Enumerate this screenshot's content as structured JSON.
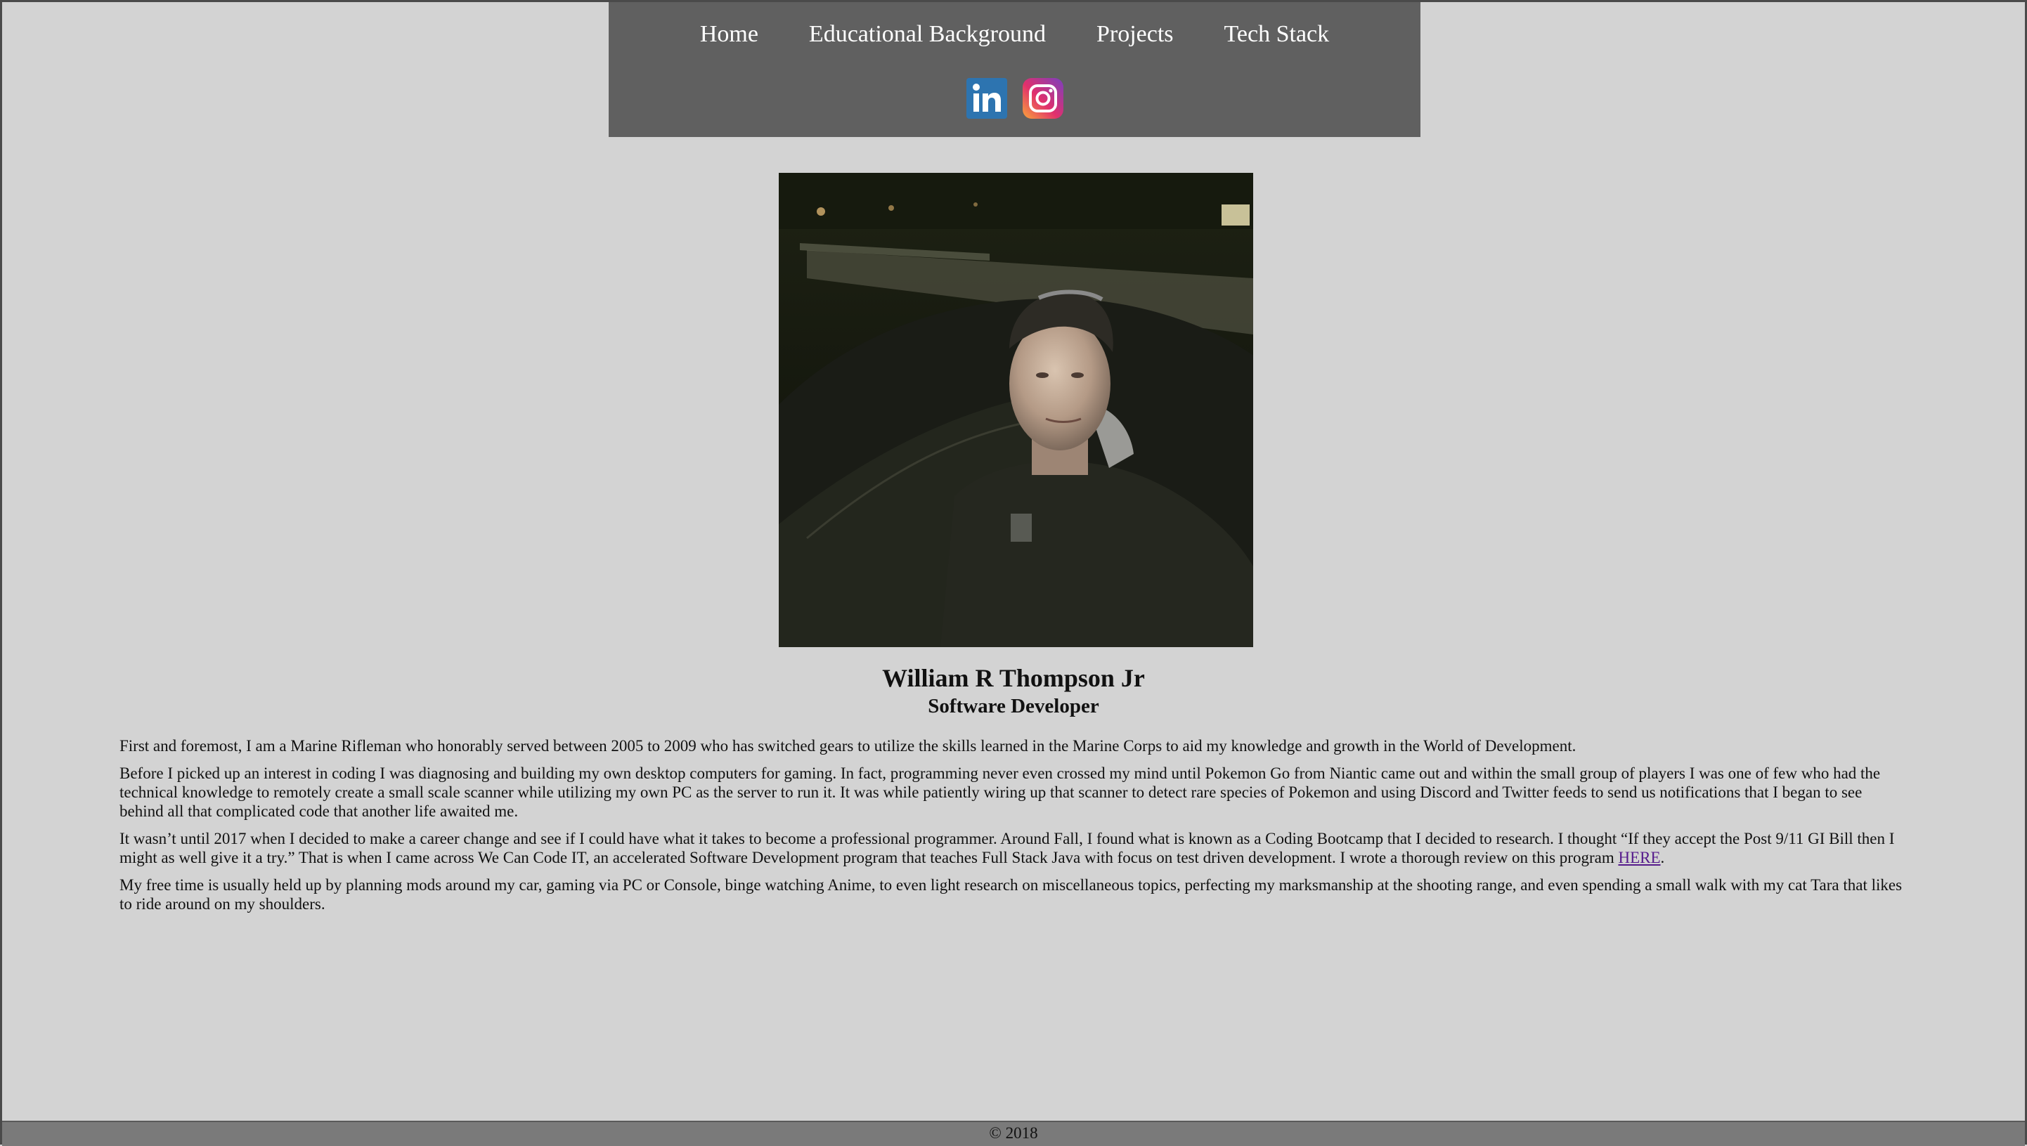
{
  "nav": {
    "links": [
      {
        "label": "Home"
      },
      {
        "label": "Educational Background"
      },
      {
        "label": "Projects"
      },
      {
        "label": "Tech Stack"
      }
    ],
    "social": [
      {
        "icon": "linkedin-icon",
        "color": "#2d74b0"
      },
      {
        "icon": "instagram-icon",
        "color": "#d62976"
      }
    ]
  },
  "profile": {
    "name": "William R Thompson Jr",
    "role": "Software Developer"
  },
  "bio": {
    "p1": "First and foremost, I am a Marine Rifleman who honorably served between 2005 to 2009 who has switched gears to utilize the skills learned in the Marine Corps to aid my knowledge and growth in the World of Development.",
    "p2": "Before I picked up an interest in coding I was diagnosing and building my own desktop computers for gaming. In fact, programming never even crossed my mind until Pokemon Go from Niantic came out and within the small group of players I was one of few who had the technical knowledge to remotely create a small scale scanner while utilizing my own PC as the server to run it. It was while patiently wiring up that scanner to detect rare species of Pokemon and using Discord and Twitter feeds to send us notifications that I began to see behind all that complicated code that another life awaited me.",
    "p3_text": "It wasn’t until 2017 when I decided to make a career change and see if I could have what it takes to become a professional programmer. Around Fall, I found what is known as a Coding Bootcamp that I decided to research. I thought “If they accept the Post 9/11 GI Bill then I might as well give it a try.” That is when I came across We Can Code IT, an accelerated Software Development program that teaches Full Stack Java with focus on test driven development. I wrote a thorough review on this program ",
    "p3_link": "HERE",
    "p3_end": ".",
    "p4": "My free time is usually held up by planning mods around my car, gaming via PC or Console, binge watching Anime, to even light research on miscellaneous topics, perfecting my marksmanship at the shooting range, and even spending a small walk with my cat Tara that likes to ride around on my shoulders."
  },
  "footer": {
    "text": "© 2018"
  }
}
